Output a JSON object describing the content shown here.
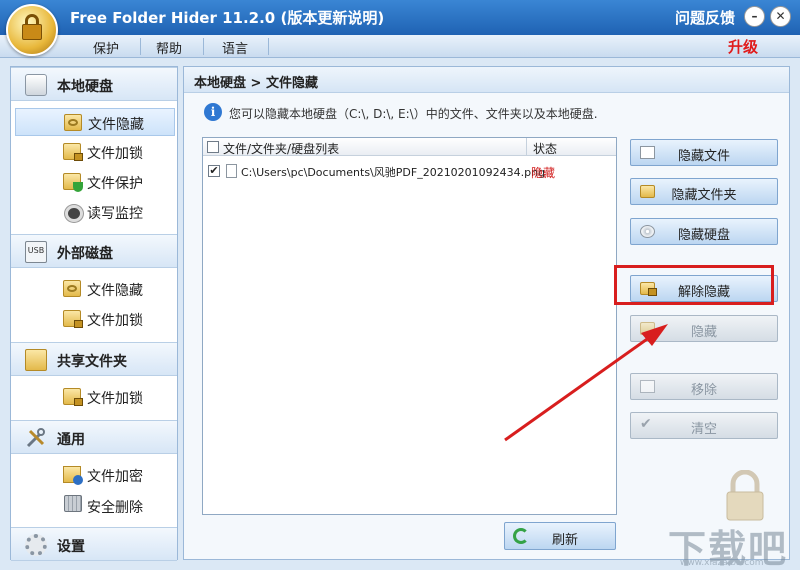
{
  "window": {
    "title": "Free Folder Hider 11.2.0 (版本更新说明)",
    "feedback": "问题反馈",
    "minimize": "–",
    "close": "✕"
  },
  "menu": {
    "items": [
      "保护",
      "帮助",
      "语言"
    ],
    "upgrade": "升级"
  },
  "sidebar": {
    "sections": [
      {
        "title": "本地硬盘",
        "icon": "hard-disk-icon",
        "items": [
          {
            "label": "文件隐藏",
            "icon": "folder-hide-icon",
            "active": true
          },
          {
            "label": "文件加锁",
            "icon": "folder-lock-icon"
          },
          {
            "label": "文件保护",
            "icon": "folder-protect-icon"
          },
          {
            "label": "读写监控",
            "icon": "monitor-icon"
          }
        ]
      },
      {
        "title": "外部磁盘",
        "icon": "usb-disk-icon",
        "usb_text": "USB",
        "items": [
          {
            "label": "文件隐藏",
            "icon": "folder-hide-icon"
          },
          {
            "label": "文件加锁",
            "icon": "folder-lock-icon"
          }
        ]
      },
      {
        "title": "共享文件夹",
        "icon": "shared-folder-icon",
        "items": [
          {
            "label": "文件加锁",
            "icon": "folder-lock-icon"
          }
        ]
      },
      {
        "title": "通用",
        "icon": "tools-icon",
        "items": [
          {
            "label": "文件加密",
            "icon": "file-encrypt-icon"
          },
          {
            "label": "安全删除",
            "icon": "shredder-icon"
          }
        ]
      },
      {
        "title": "设置",
        "icon": "gear-icon",
        "items": []
      }
    ]
  },
  "main": {
    "breadcrumb": "本地硬盘 > 文件隐藏",
    "info": "您可以隐藏本地硬盘（C:\\, D:\\, E:\\）中的文件、文件夹以及本地硬盘.",
    "list": {
      "col_path": "文件/文件夹/硬盘列表",
      "col_status": "状态",
      "rows": [
        {
          "checked": true,
          "path": "C:\\Users\\pc\\Documents\\风驰PDF_20210201092434.png",
          "status": "隐藏"
        }
      ]
    },
    "buttons": {
      "hide_file": "隐藏文件",
      "hide_folder": "隐藏文件夹",
      "hide_disk": "隐藏硬盘",
      "unhide": "解除隐藏",
      "hide": "隐藏",
      "remove": "移除",
      "clear": "清空",
      "refresh": "刷新"
    },
    "check_mark": "✔"
  },
  "watermark": {
    "brand": "下载吧",
    "domain": "www.xiazaiba.com"
  },
  "colors": {
    "accent": "#1f62b3",
    "highlight": "#d81e1e",
    "status_hidden": "#d21f1f",
    "upgrade": "#e01b1b"
  }
}
